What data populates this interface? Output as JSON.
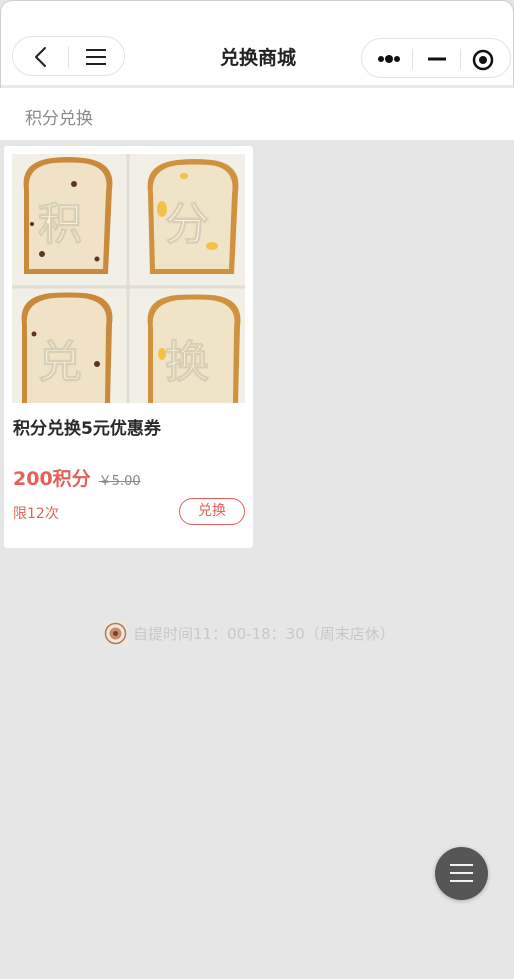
{
  "header": {
    "title": "兑换商城",
    "back_icon": "chevron-left-icon",
    "menu_icon": "hamburger-icon",
    "more_icon": "more-dots-icon",
    "minimize_icon": "minimize-icon",
    "close_icon": "target-circle-icon"
  },
  "tab": {
    "label": "积分兑换"
  },
  "product": {
    "image_chars": [
      "积",
      "分",
      "兑",
      "换"
    ],
    "title": "积分兑换5元优惠券",
    "points_price": "200积分",
    "original_price": "￥5.00",
    "limit": "限12次",
    "exchange_label": "兑换"
  },
  "notice": {
    "text": "自提时间11：00-18：30（周末店休）"
  },
  "fab": {
    "icon": "menu-icon"
  },
  "colors": {
    "accent": "#e65f5a",
    "background": "#e6e6e6",
    "fab": "#565656"
  }
}
